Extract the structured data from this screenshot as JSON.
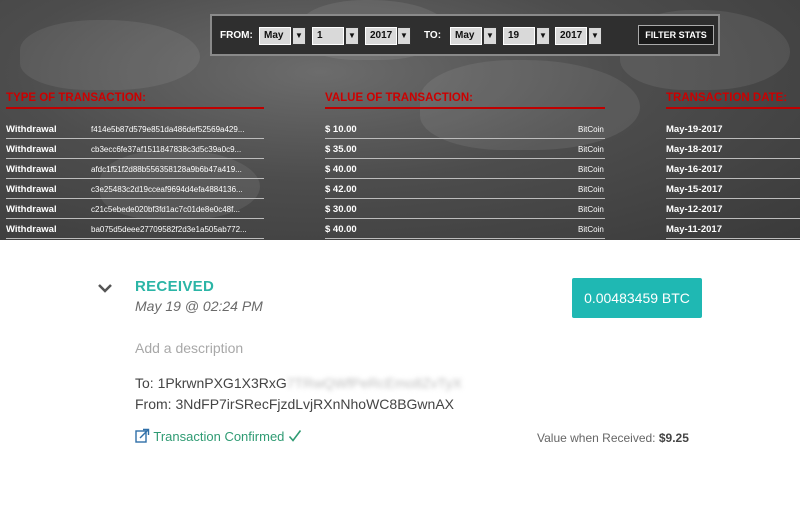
{
  "filter": {
    "from_label": "FROM:",
    "from_month": "May",
    "from_day": "1",
    "from_year": "2017",
    "to_label": "TO:",
    "to_month": "May",
    "to_day": "19",
    "to_year": "2017",
    "button_label": "FILTER STATS"
  },
  "table": {
    "headers": [
      "TYPE OF TRANSACTION:",
      "VALUE OF TRANSACTION:",
      "TRANSACTION DATE:"
    ],
    "rows": [
      {
        "type": "Withdrawal",
        "hash": "f414e5b87d579e851da486def52569a429...",
        "value": "$ 10.00",
        "coin": "BitCoin",
        "date": "May-19-2017"
      },
      {
        "type": "Withdrawal",
        "hash": "cb3ecc6fe37af1511847838c3d5c39a0c9...",
        "value": "$ 35.00",
        "coin": "BitCoin",
        "date": "May-18-2017"
      },
      {
        "type": "Withdrawal",
        "hash": "afdc1f51f2d88b556358128a9b6b47a419...",
        "value": "$ 40.00",
        "coin": "BitCoin",
        "date": "May-16-2017"
      },
      {
        "type": "Withdrawal",
        "hash": "c3e25483c2d19cceaf9694d4efa4884136...",
        "value": "$ 42.00",
        "coin": "BitCoin",
        "date": "May-15-2017"
      },
      {
        "type": "Withdrawal",
        "hash": "c21c5ebede020bf3fd1ac7c01de8e0c48f...",
        "value": "$ 30.00",
        "coin": "BitCoin",
        "date": "May-12-2017"
      },
      {
        "type": "Withdrawal",
        "hash": "ba075d5deee27709582f2d3e1a505ab772...",
        "value": "$ 40.00",
        "coin": "BitCoin",
        "date": "May-11-2017"
      }
    ]
  },
  "transaction": {
    "status": "RECEIVED",
    "datetime": "May 19 @ 02:24 PM",
    "amount": "0.00483459 BTC",
    "description_placeholder": "Add a description",
    "to_label": "To: ",
    "to_address": "1PkrwnPXG1X3RxG",
    "to_address_blurred": "7TRwQWfPeRcEmo8ZvTyX",
    "from_label": "From: ",
    "from_address": "3NdFP7irSRecFjzdLvjRXnNhoWC8BGwnAX",
    "confirmation": "Transaction Confirmed",
    "value_label": "Value when Received: ",
    "value_amount": "$9.25"
  },
  "colors": {
    "accent_teal": "#1fb8b3",
    "status_green": "#2f9b73",
    "header_red": "#cc0000"
  }
}
